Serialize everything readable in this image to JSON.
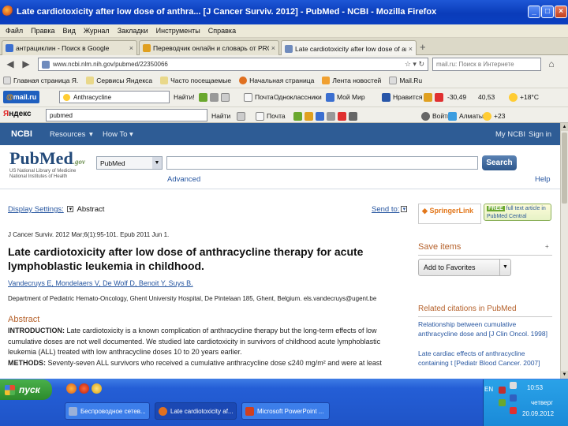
{
  "window": {
    "title": "Late cardiotoxicity after low dose of anthra... [J Cancer Surviv. 2012] - PubMed - NCBI - Mozilla Firefox"
  },
  "menu": [
    "Файл",
    "Правка",
    "Вид",
    "Журнал",
    "Закладки",
    "Инструменты",
    "Справка"
  ],
  "tabs": [
    {
      "label": "антрациклин - Поиск в Google",
      "color": "#3b6fd0"
    },
    {
      "label": "Переводчик онлайн и словарь от PRO...",
      "color": "#e0a020"
    },
    {
      "label": "Late cardiotoxicity after low dose of anthr...",
      "color": "#6f8bbd"
    }
  ],
  "nav": {
    "url": "www.ncbi.nlm.nih.gov/pubmed/22350066",
    "search_placeholder": "mail.ru: Поиск в Интернете"
  },
  "bookmarks": [
    "Главная страница Я.",
    "Сервисы Яндекса",
    "Часто посещаемые",
    "Начальная страница",
    "Лента новостей",
    "Mail.Ru"
  ],
  "mailbar": {
    "logo_at": "@",
    "logo": "mail.ru",
    "search_value": "Anthracycline",
    "find": "Найти!",
    "items": [
      "Почта",
      "Одноклассники",
      "Мой Мир",
      "Нравится",
      "-30,49",
      "40,53",
      "+18°C"
    ]
  },
  "yabar": {
    "logo_y": "Я",
    "logo": "ндекс",
    "search_value": "pubmed",
    "find": "Найти",
    "items": [
      "Почта",
      "Войти",
      "Алматы",
      "+23"
    ]
  },
  "ncbi": {
    "logo": "NCBI",
    "resources": "Resources",
    "howto": "How To",
    "myncbi": "My NCBI",
    "signin": "Sign in"
  },
  "pubmed": {
    "logo_main": "PubMed",
    "logo_gov": ".gov",
    "sub": "US National Library of Medicine National Institutes of Health",
    "db": "PubMed",
    "search_button": "Search",
    "advanced": "Advanced",
    "help": "Help"
  },
  "article": {
    "display_settings": "Display Settings:",
    "format": "Abstract",
    "send_to": "Send to:",
    "citation": "J Cancer Surviv. 2012 Mar;6(1):95-101. Epub 2011 Jun 1.",
    "title": "Late cardiotoxicity after low dose of anthracycline therapy for acute lymphoblastic leukemia in childhood.",
    "authors": "Vandecruys E, Mondelaers V, De Wolf D, Benoit Y, Suys B.",
    "affiliation": "Department of Pediatric Hemato-Oncology, Ghent University Hospital, De Pintelaan 185, Ghent, Belgium. els.vandecruys@ugent.be",
    "abstract_label": "Abstract",
    "intro_label": "INTRODUCTION:",
    "intro_text": "Late cardiotoxicity is a known complication of anthracycline therapy but the long-term effects of low cumulative doses are not well documented. We studied late cardiotoxicity in survivors of childhood acute lymphoblastic leukemia (ALL) treated with low anthracycline doses 10 to 20 years earlier.",
    "methods_label": "METHODS:",
    "methods_text": "Seventy-seven ALL survivors who received a cumulative anthracycline dose ≤240 mg/m² and were at least"
  },
  "sidebar": {
    "springer": "SpringerLink",
    "free_badge": "FREE",
    "free_text": "full text article in PubMed Central",
    "save_items": "Save items",
    "add_favorites": "Add to Favorites",
    "related_title": "Related citations in PubMed",
    "related": [
      "Relationship between cumulative anthracycline dose and [J Clin Oncol. 1998]",
      "Late cardiac effects of anthracycline containing t [Pediatr Blood Cancer. 2007]"
    ]
  },
  "taskbar": {
    "start": "пуск",
    "tasks": [
      {
        "label": "Беспроводное сетев...",
        "color": "#9ab0d8"
      },
      {
        "label": "Late cardiotoxicity af...",
        "color": "#e07020"
      },
      {
        "label": "Microsoft PowerPoint ...",
        "color": "#d04020"
      }
    ],
    "lang": "EN",
    "time": "10:53",
    "day": "четверг",
    "date": "20.09.2012"
  }
}
